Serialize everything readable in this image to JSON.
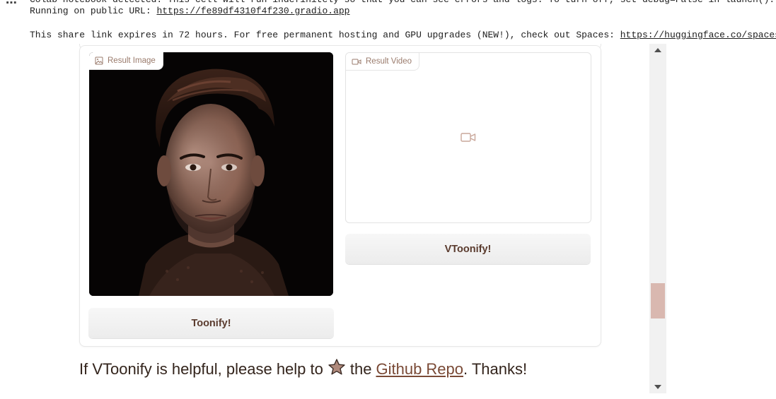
{
  "console": {
    "line1": "Colab notebook detected. This cell will run indefinitely so that you can see errors and logs. To turn off, set debug=False in launch().",
    "line2_prefix": "Running on public URL: ",
    "line2_url": "https://fe89df4310f4f230.gradio.app",
    "line3_prefix": "This share link expires in 72 hours. For free permanent hosting and GPU upgrades (NEW!), check out Spaces: ",
    "line3_url": "https://huggingface.co/spaces"
  },
  "result_image": {
    "label": "Result Image",
    "icon": "image-icon"
  },
  "result_video": {
    "label": "Result Video",
    "icon": "video-icon"
  },
  "buttons": {
    "vtoonify": "VToonify!",
    "toonify": "Toonify!"
  },
  "footer": {
    "prefix": "If VToonify is helpful, please help to",
    "star_icon": "star-icon",
    "middle": "the",
    "link": "Github Repo",
    "suffix": ". Thanks!"
  },
  "colors": {
    "accent": "#5a3b2e",
    "label_text": "#9a7b6c",
    "scroll_thumb": "#d9b8b0"
  }
}
